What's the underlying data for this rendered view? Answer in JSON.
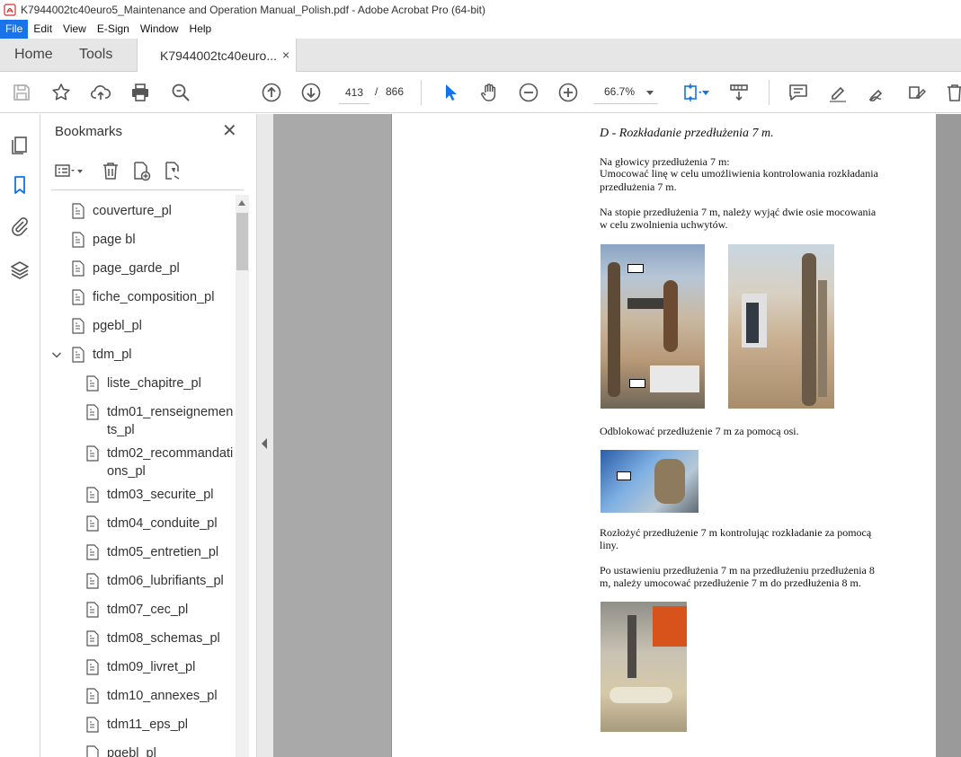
{
  "window": {
    "title": "K7944002tc40euro5_Maintenance and Operation Manual_Polish.pdf - Adobe Acrobat Pro (64-bit)"
  },
  "menu": [
    "File",
    "Edit",
    "View",
    "E-Sign",
    "Window",
    "Help"
  ],
  "tabs": {
    "home": "Home",
    "tools": "Tools",
    "document": "K7944002tc40euro...",
    "close_glyph": "×"
  },
  "toolbar": {
    "page_current": "413",
    "page_separator": "/",
    "page_total": "866",
    "zoom": "66.7%"
  },
  "bookmarks": {
    "title": "Bookmarks",
    "close_glyph": "✕",
    "items": [
      {
        "label": "couverture_pl",
        "level": 0
      },
      {
        "label": "page bl",
        "level": 0
      },
      {
        "label": "page_garde_pl",
        "level": 0
      },
      {
        "label": "fiche_composition_pl",
        "level": 0
      },
      {
        "label": "pgebl_pl",
        "level": 0
      },
      {
        "label": "tdm_pl",
        "level": 0,
        "expanded": true
      },
      {
        "label": "liste_chapitre_pl",
        "level": 1
      },
      {
        "label": "tdm01_renseignements_pl",
        "level": 1
      },
      {
        "label": "tdm02_recommandations_pl",
        "level": 1
      },
      {
        "label": "tdm03_securite_pl",
        "level": 1
      },
      {
        "label": "tdm04_conduite_pl",
        "level": 1
      },
      {
        "label": "tdm05_entretien_pl",
        "level": 1
      },
      {
        "label": "tdm06_lubrifiants_pl",
        "level": 1
      },
      {
        "label": "tdm07_cec_pl",
        "level": 1
      },
      {
        "label": "tdm08_schemas_pl",
        "level": 1
      },
      {
        "label": "tdm09_livret_pl",
        "level": 1
      },
      {
        "label": "tdm10_annexes_pl",
        "level": 1
      },
      {
        "label": "tdm11_eps_pl",
        "level": 1
      },
      {
        "label": "pgebl_pl",
        "level": 1
      }
    ]
  },
  "document": {
    "heading": "D - Rozkładanie przedłużenia 7 m.",
    "para1_line1": "Na głowicy przedłużenia 7 m:",
    "para1_line2": "Umocować linę w celu umożliwienia kontrolowania rozkładania",
    "para1_line3": "przedłużenia 7 m.",
    "para2_line1": "Na stopie przedłużenia 7 m, należy wyjąć dwie osie mocowania",
    "para2_line2": "w celu zwolnienia uchwytów.",
    "para3": "Odblokować przedłużenie 7 m za pomocą osi.",
    "para4_line1": "Rozłożyć przedłużenie 7 m kontrolując rozkładanie za pomocą",
    "para4_line2": "liny.",
    "para5_line1": "Po ustawieniu przedłużenia 7 m na przedłużeniu przedłużenia 8",
    "para5_line2": "m, należy umocować przedłużenie 7 m do przedłużenia 8 m."
  }
}
